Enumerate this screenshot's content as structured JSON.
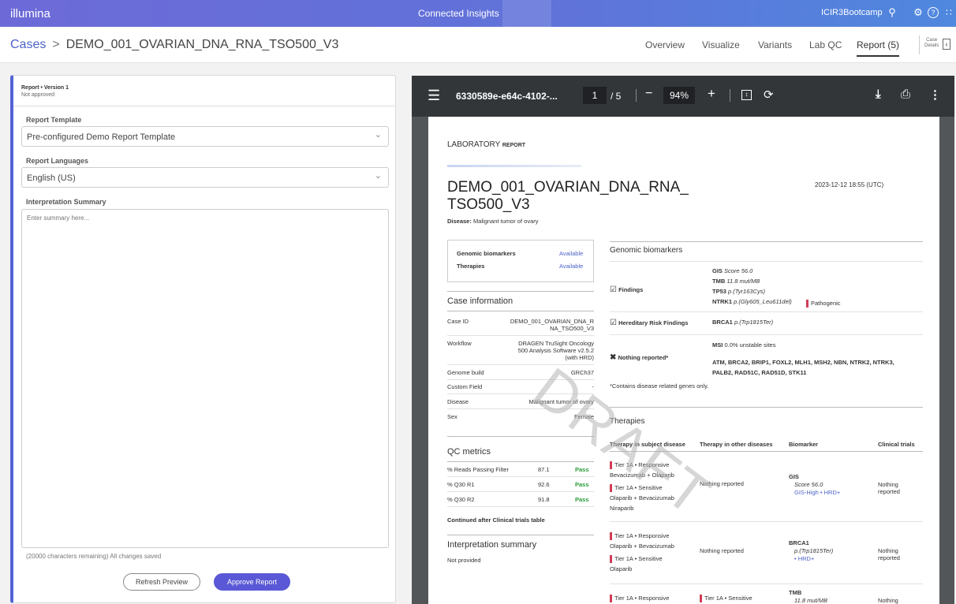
{
  "topbar": {
    "logo": "illumina",
    "app_title": "Connected Insights",
    "user": "ICIR3Bootcamp"
  },
  "header": {
    "breadcrumb_root": "Cases",
    "breadcrumb_sep": ">",
    "case_name": "DEMO_001_OVARIAN_DNA_RNA_TSO500_V3",
    "tabs": [
      "Overview",
      "Visualize",
      "Variants",
      "Lab QC",
      "Report (5)"
    ],
    "case_details_line1": "Case",
    "case_details_line2": "Details"
  },
  "left_panel": {
    "report_version": "Report • Version 1",
    "approval_status": "Not approved",
    "template_label": "Report Template",
    "template_value": "Pre-configured Demo Report Template",
    "languages_label": "Report Languages",
    "language_value": "English (US)",
    "summary_label": "Interpretation Summary",
    "summary_placeholder": "Enter summary here...",
    "remaining": "(20000 characters remaining) All changes saved",
    "refresh_button": "Refresh Preview",
    "approve_button": "Approve Report"
  },
  "pdf_toolbar": {
    "filename": "6330589e-e64c-4102-...",
    "page_current": "1",
    "page_total": "/ 5",
    "zoom": "94%"
  },
  "report": {
    "lab": "LABORATORY",
    "lab_sub": "REPORT",
    "title_line1": "DEMO_001_OVARIAN_DNA_RNA_",
    "title_line2": "TSO500_V3",
    "timestamp": "2023-12-12 18:55 (UTC)",
    "disease_label": "Disease:",
    "disease_value": "Malignant tumor of ovary",
    "summary_box": [
      {
        "label": "Genomic biomarkers",
        "value": "Available"
      },
      {
        "label": "Therapies",
        "value": "Available"
      }
    ],
    "case_info_title": "Case information",
    "case_info": [
      {
        "label": "Case ID",
        "value1": "DEMO_001_OVARIAN_DNA_R",
        "value2": "NA_TSO500_V3",
        "value3": ""
      },
      {
        "label": "Workflow",
        "value1": "DRAGEN TruSight Oncology",
        "value2": "500 Analysis Software v2.5.2",
        "value3": "(with HRD)"
      },
      {
        "label": "Genome build",
        "value1": "GRCh37",
        "value2": "",
        "value3": ""
      },
      {
        "label": "Custom Field",
        "value1": "-",
        "value2": "",
        "value3": ""
      },
      {
        "label": "Disease",
        "value1": "Malignant tumor of ovary",
        "value2": "",
        "value3": ""
      },
      {
        "label": "Sex",
        "value1": "Female",
        "value2": "",
        "value3": ""
      }
    ],
    "qc_title": "QC metrics",
    "qc": [
      {
        "metric": "% Reads Passing Filter",
        "value": "87.1",
        "status": "Pass"
      },
      {
        "metric": "% Q30 R1",
        "value": "92.6",
        "status": "Pass"
      },
      {
        "metric": "% Q30 R2",
        "value": "91.8",
        "status": "Pass"
      }
    ],
    "qc_note": "Continued after Clinical trials table",
    "interp_title": "Interpretation summary",
    "interp_value": "Not provided",
    "gb_title": "Genomic biomarkers",
    "findings_label": "Findings",
    "findings": [
      {
        "gene": "GIS",
        "detail": "Score 56.0"
      },
      {
        "gene": "TMB",
        "detail": "11.8 mut/MB"
      },
      {
        "gene": "TP53",
        "detail": "p.(Tyr163Cys)"
      },
      {
        "gene": "NTRK1",
        "detail": "p.(Gly605_Leu611del)"
      }
    ],
    "pathogenic": "Pathogenic",
    "hereditary_label": "Hereditary Risk Findings",
    "hereditary_gene": "BRCA1",
    "hereditary_detail": "p.(Trp1815Ter)",
    "nothing_label": "Nothing reported*",
    "msi_label": "MSI",
    "msi_value": "0.0% unstable sites",
    "nothing_genes1": "ATM, BRCA2, BRIP1, FOXL2, MLH1, MSH2, NBN, NTRK2, NTRK3,",
    "nothing_genes2": "PALB2, RAD51C, RAD51D, STK11",
    "footnote": "*Contains disease related genes only.",
    "therapies_title": "Therapies",
    "therapy_headers": [
      "Therapy in subject disease",
      "Therapy in other diseases",
      "Biomarker",
      "Clinical trials"
    ],
    "therapy_rows": [
      {
        "t1_tier": "Tier 1A • Responsive",
        "t1_drug": "Bevacizumab + Olaparib",
        "t2_tier": "Tier 1A • Sensitive",
        "t2_drug1": "Olaparib + Bevacizumab",
        "t2_drug2": "Niraparib",
        "other": "Nothing reported",
        "bm": "GIS",
        "bm_detail": "Score 56.0",
        "bm_link": "GIS-High • HRD+",
        "ct1": "Nothing",
        "ct2": "reported"
      },
      {
        "t1_tier": "Tier 1A • Responsive",
        "t1_drug": "Olaparib + Bevacizumab",
        "t2_tier": "Tier 1A • Sensitive",
        "t2_drug1": "Olaparib",
        "t2_drug2": "",
        "other": "Nothing reported",
        "bm": "BRCA1",
        "bm_detail": "p.(Trp1815Ter)",
        "bm_link": "• HRD+",
        "ct1": "Nothing",
        "ct2": "reported"
      },
      {
        "t1_tier": "Tier 1A • Responsive",
        "other_tier": "Tier 1A • Sensitive",
        "bm": "TMB",
        "bm_detail": "11.8 mut/MB",
        "ct1": "Nothing"
      }
    ],
    "watermark": "DRAFT"
  }
}
